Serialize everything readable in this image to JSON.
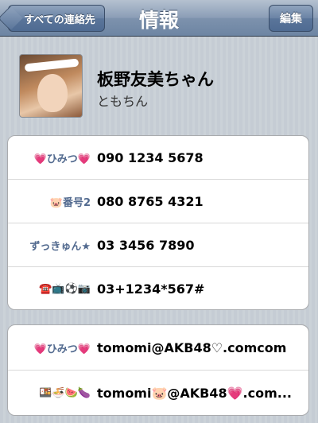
{
  "navbar": {
    "back_label": "すべての連絡先",
    "title": "情報",
    "edit_label": "編集"
  },
  "contact": {
    "name": "板野友美ちゃん",
    "nickname": "ともちん"
  },
  "phones": [
    {
      "label": "💗ひみつ💗",
      "value": "090 1234 5678"
    },
    {
      "label": "🐷番号2",
      "value": "080 8765 4321"
    },
    {
      "label": "ずっきゅん★",
      "value": "03 3456 7890"
    },
    {
      "label": "☎️📺⚽📷",
      "value": "03+1234*567#"
    }
  ],
  "emails": [
    {
      "label": "💗ひみつ💗",
      "value": "tomomi@AKB48♡.comcom"
    },
    {
      "label": "🍱🍜🍉🍆",
      "value": "tomomi🐷@AKB48💗.com..."
    }
  ]
}
